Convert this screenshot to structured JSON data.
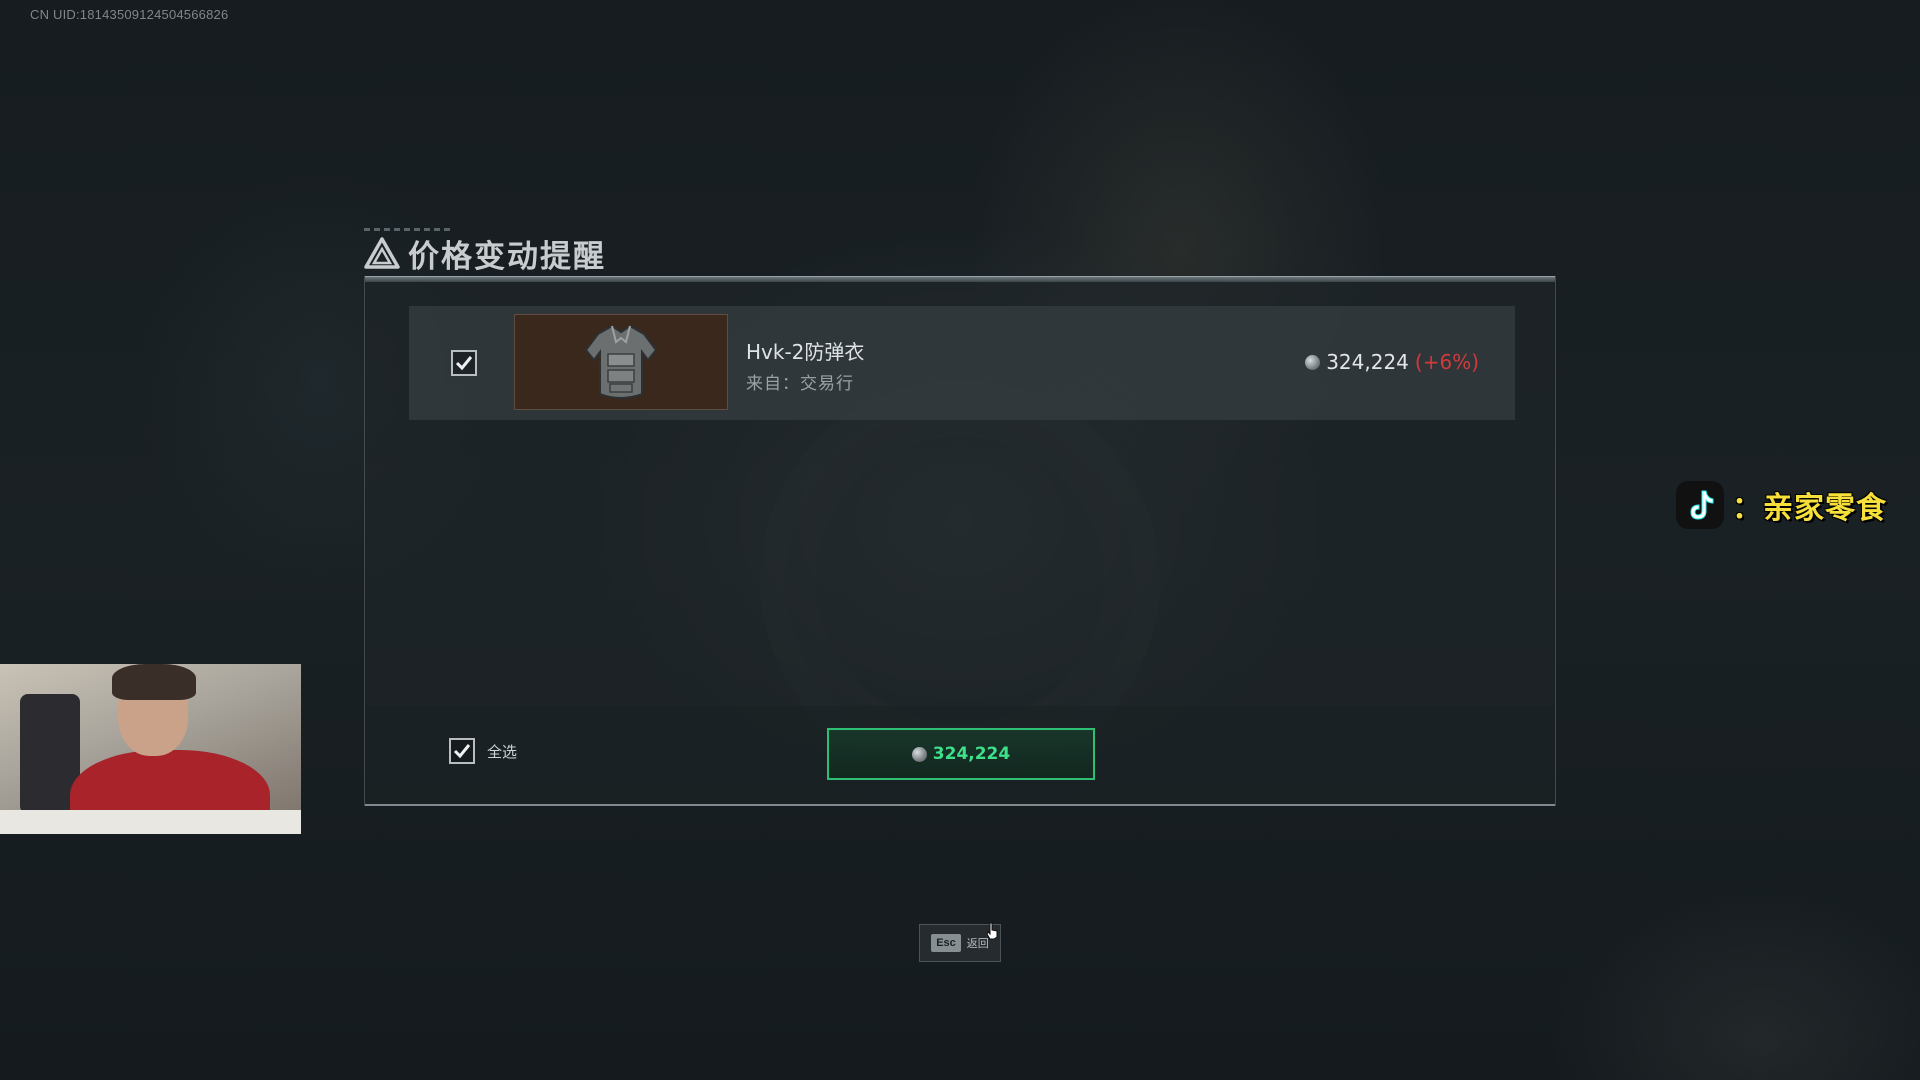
{
  "uid_label": "CN UID:18143509124504566826",
  "dialog": {
    "title": "价格变动提醒",
    "items": [
      {
        "name": "Hvk-2防弹衣",
        "source": "来自：交易行",
        "price": "324,224",
        "change": "(+6%)",
        "checked": true
      }
    ],
    "select_all_label": "全选",
    "select_all_checked": true,
    "confirm_total": "324,224"
  },
  "esc_hint": {
    "key": "Esc",
    "label": "返回"
  },
  "watermark": {
    "text": "：亲家零食"
  },
  "colors": {
    "accent_green": "#3ee08a",
    "price_increase_red": "#d03a3a",
    "watermark_yellow": "#f7e03a"
  }
}
